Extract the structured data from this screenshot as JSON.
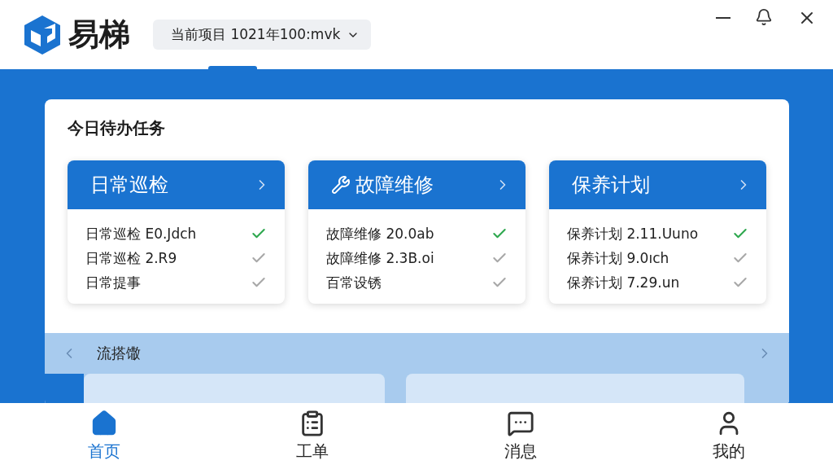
{
  "app": {
    "name": "易梯"
  },
  "project": {
    "label": "当前项目 1021年100:mvk"
  },
  "todo": {
    "title": "今日待办任务",
    "groups": [
      {
        "title": "日常巡检",
        "items": [
          {
            "text": "日常巡检 E0.Jdch",
            "done": true
          },
          {
            "text": "日常巡检 2.R9",
            "done": false
          },
          {
            "text": "日常提事",
            "done": false
          }
        ]
      },
      {
        "title": "故障维修",
        "items": [
          {
            "text": "故障维修 20.0ab",
            "done": true
          },
          {
            "text": "故障维修 2.3B.oi",
            "done": false
          },
          {
            "text": "百常设锈",
            "done": false
          }
        ]
      },
      {
        "title": "保养计划",
        "items": [
          {
            "text": "保养计划 2.11.Uuno",
            "done": true
          },
          {
            "text": "保养计划 9.0ıch",
            "done": false
          },
          {
            "text": "保养计划 7.29.un",
            "done": false
          }
        ]
      }
    ]
  },
  "strip": {
    "title": "流搭馓"
  },
  "nav": [
    {
      "label": "首页",
      "selected": true
    },
    {
      "label": "工单",
      "selected": false
    },
    {
      "label": "消息",
      "selected": false
    },
    {
      "label": "我的",
      "selected": false
    }
  ]
}
